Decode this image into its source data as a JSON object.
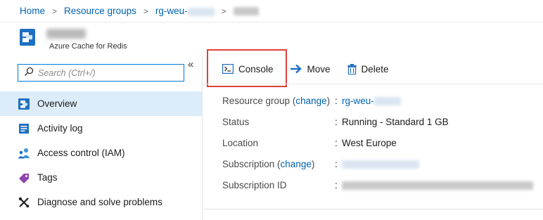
{
  "breadcrumb": {
    "items": [
      "Home",
      "Resource groups",
      "rg-weu-"
    ],
    "separator": ">"
  },
  "resource": {
    "type_label": "Azure Cache for Redis"
  },
  "sidebar": {
    "collapse_label": "«",
    "search_placeholder": "Search (Ctrl+/)",
    "items": [
      {
        "label": "Overview",
        "icon": "redis-overview-icon",
        "active": true
      },
      {
        "label": "Activity log",
        "icon": "activity-log-icon"
      },
      {
        "label": "Access control (IAM)",
        "icon": "iam-people-icon"
      },
      {
        "label": "Tags",
        "icon": "tag-icon"
      },
      {
        "label": "Diagnose and solve problems",
        "icon": "wrench-cross-icon"
      }
    ]
  },
  "toolbar": {
    "console_label": "Console",
    "move_label": "Move",
    "delete_label": "Delete"
  },
  "properties": {
    "resource_group_label": "Resource group",
    "change_label": "change",
    "resource_group_value": "rg-weu-",
    "status_label": "Status",
    "status_value": "Running - Standard 1 GB",
    "location_label": "Location",
    "location_value": "West Europe",
    "subscription_label": "Subscription",
    "subscription_id_label": "Subscription ID",
    "colon": ":"
  },
  "colors": {
    "link": "#0063b1",
    "active_nav": "#dcecf8",
    "highlight_border": "#e0403a",
    "azure_blue": "#0078d4"
  }
}
